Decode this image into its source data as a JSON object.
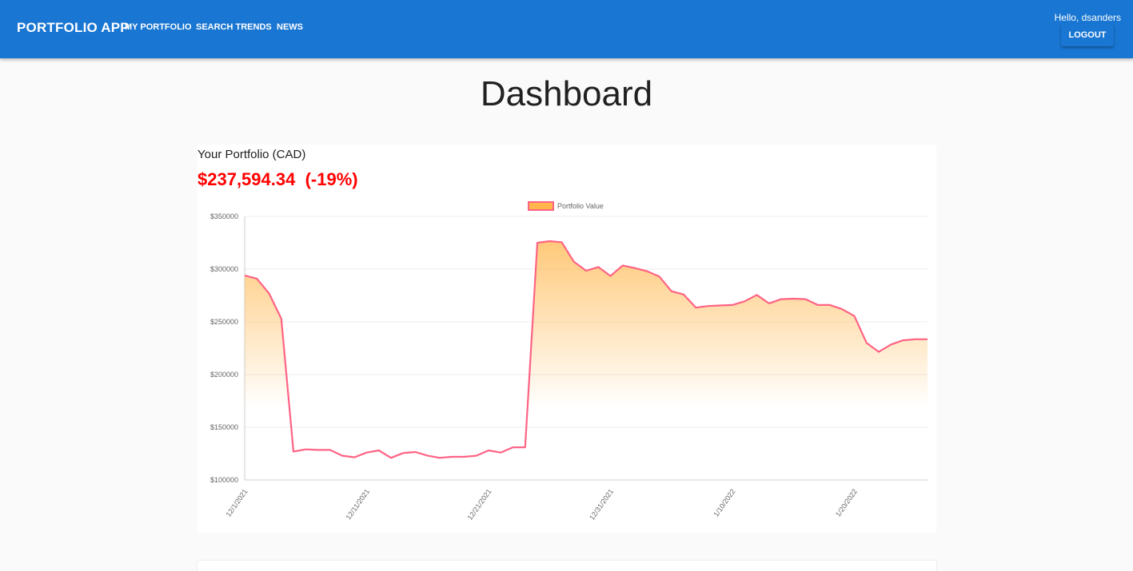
{
  "header": {
    "brand": "PORTFOLIO APP",
    "nav": [
      "MY PORTFOLIO",
      "SEARCH TRENDS",
      "NEWS"
    ],
    "greeting": "Hello, dsanders",
    "logout_label": "LOGOUT",
    "color": "#1976d2"
  },
  "page": {
    "title": "Dashboard"
  },
  "portfolio": {
    "title": "Your Portfolio (CAD)",
    "value": "$237,594.34",
    "change": "(-19%)",
    "value_color": "#ff0000"
  },
  "chart_data": {
    "type": "area",
    "legend": [
      "Portfolio Value"
    ],
    "legend_position": "top",
    "grid": true,
    "ylim": [
      100000,
      350000
    ],
    "yticks": [
      "$350000",
      "$300000",
      "$250000",
      "$200000",
      "$150000",
      "$100000"
    ],
    "xticks": [
      "12/1/2021",
      "12/11/2021",
      "12/21/2021",
      "12/31/2021",
      "1/10/2022",
      "1/20/2022"
    ],
    "x_start": "12/1/2021",
    "line_color": "#ff6384",
    "fill_color": "#ffb74d",
    "series": [
      {
        "name": "Portfolio Value",
        "values": [
          294000,
          291000,
          277000,
          253000,
          127000,
          129000,
          128500,
          128500,
          123000,
          121500,
          126000,
          128000,
          121000,
          125500,
          126500,
          123000,
          121000,
          122000,
          122000,
          123000,
          128000,
          126000,
          131000,
          131000,
          325000,
          326500,
          325500,
          307000,
          298500,
          302000,
          293500,
          303500,
          301000,
          298000,
          293000,
          279000,
          276000,
          263500,
          265000,
          265500,
          266000,
          269500,
          275500,
          267500,
          271500,
          272000,
          271500,
          266000,
          266000,
          262000,
          255500,
          230000,
          221500,
          228500,
          232500,
          233500,
          233500
        ]
      }
    ]
  }
}
